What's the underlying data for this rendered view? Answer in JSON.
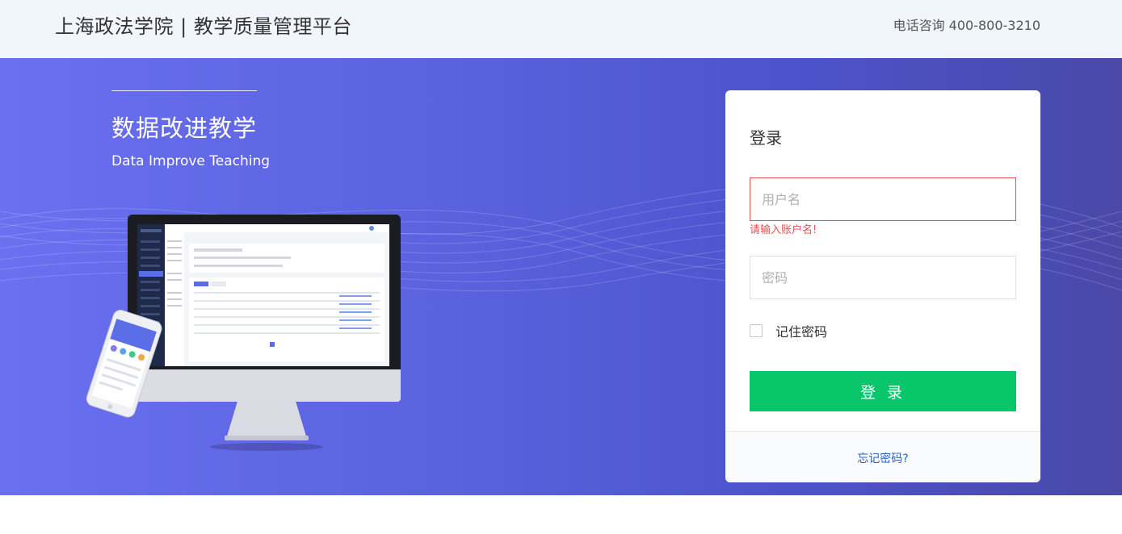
{
  "header": {
    "brand": "上海政法学院 | 教学质量管理平台",
    "phone": "电话咨询 400-800-3210"
  },
  "hero": {
    "title": "数据改进教学",
    "subtitle": "Data Improve Teaching"
  },
  "login": {
    "title": "登录",
    "username_placeholder": "用户名",
    "username_value": "",
    "username_error": "请输入账户名!",
    "password_placeholder": "密码",
    "password_value": "",
    "remember_label": "记住密码",
    "remember_checked": false,
    "submit_label": "登 录",
    "forgot_label": "忘记密码?"
  },
  "colors": {
    "hero_gradient_start": "#6a70f0",
    "hero_gradient_end": "#4a49a8",
    "submit_green": "#0ac66b",
    "error_red": "#e05252",
    "link_blue": "#2b5fc4"
  }
}
